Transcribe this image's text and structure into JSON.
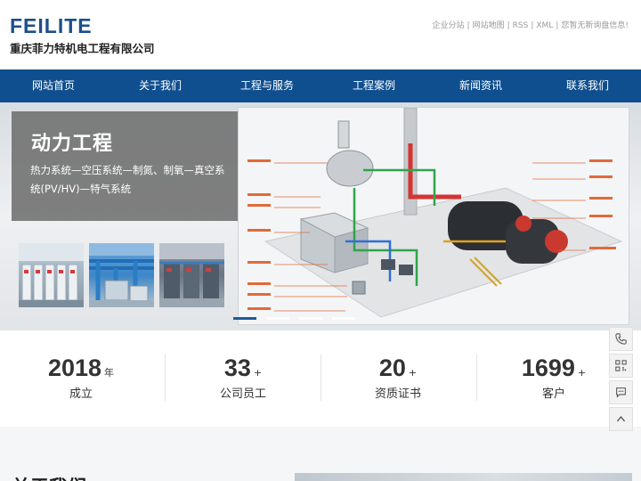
{
  "header": {
    "logo_text": "FEILITE",
    "company_name": "重庆菲力特机电工程有限公司",
    "top_links": [
      "企业分站",
      "网站地图",
      "RSS",
      "XML",
      "您暂无新询盘信息!"
    ],
    "separator": "|"
  },
  "nav": {
    "items": [
      "网站首页",
      "关于我们",
      "工程与服务",
      "工程案例",
      "新闻资讯",
      "联系我们"
    ]
  },
  "banner": {
    "title": "动力工程",
    "desc": "热力系统—空压系统—制氮、制氧—真空系统(PV/HV)—特气系统",
    "slides": 4,
    "active_slide": 0
  },
  "stats": [
    {
      "num": "2018",
      "unit": "年",
      "label": "成立"
    },
    {
      "num": "33",
      "unit": "+",
      "label": "公司员工"
    },
    {
      "num": "20",
      "unit": "+",
      "label": "资质证书"
    },
    {
      "num": "1699",
      "unit": "+",
      "label": "客户"
    }
  ],
  "about": {
    "title": "关于我们"
  },
  "colors": {
    "brand_blue": "#0f4f8f",
    "logo_blue": "#1b4f8a",
    "active_dot": "#1f5a99"
  },
  "side_icons": [
    "phone-icon",
    "qrcode-icon",
    "chat-icon",
    "back-to-top-icon"
  ]
}
